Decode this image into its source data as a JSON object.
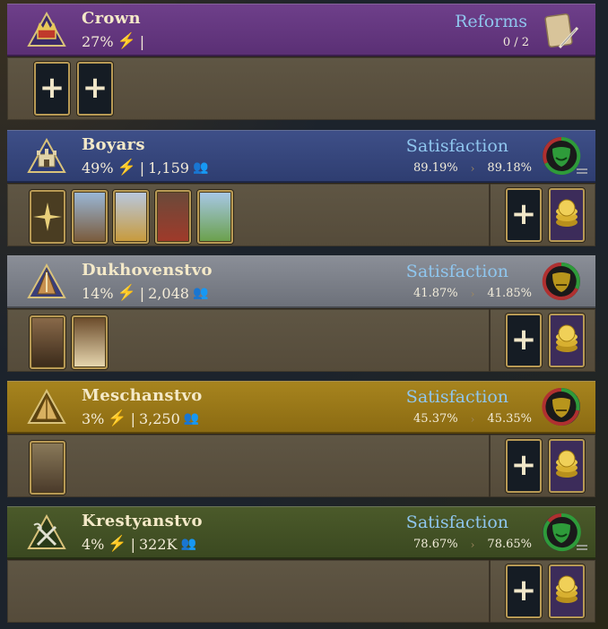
{
  "crown": {
    "name": "Crown",
    "influence": "27%",
    "separator": "|",
    "reforms_label": "Reforms",
    "reforms_count": "0 / 2"
  },
  "estates": [
    {
      "name": "Boyars",
      "influence": "49%",
      "separator": "|",
      "population": "1,159",
      "satisfaction_label": "Satisfaction",
      "satisfaction_current": "89.19%",
      "satisfaction_projected": "89.18%"
    },
    {
      "name": "Dukhovenstvo",
      "influence": "14%",
      "separator": "|",
      "population": "2,048",
      "satisfaction_label": "Satisfaction",
      "satisfaction_current": "41.87%",
      "satisfaction_projected": "41.85%"
    },
    {
      "name": "Meschanstvo",
      "influence": "3%",
      "separator": "|",
      "population": "3,250",
      "satisfaction_label": "Satisfaction",
      "satisfaction_current": "45.37%",
      "satisfaction_projected": "45.35%"
    },
    {
      "name": "Krestyanstvo",
      "influence": "4%",
      "separator": "|",
      "population": "322K",
      "satisfaction_label": "Satisfaction",
      "satisfaction_current": "78.67%",
      "satisfaction_projected": "78.65%"
    }
  ],
  "icons": {
    "plus": "+",
    "bolt": "⚡",
    "arrow": "›",
    "pop": "👥"
  },
  "colors": {
    "crown_header": "#6e3f8a",
    "boyars_header": "#3e4f88",
    "dukhovenstvo_header": "#8a8e97",
    "meschanstvo_header": "#a7841e",
    "krestyanstvo_header": "#4b5a2a",
    "satisfaction_text": "#8fc6ee",
    "happy_face": "#2e9b3a",
    "neutral_face": "#b8951c"
  }
}
